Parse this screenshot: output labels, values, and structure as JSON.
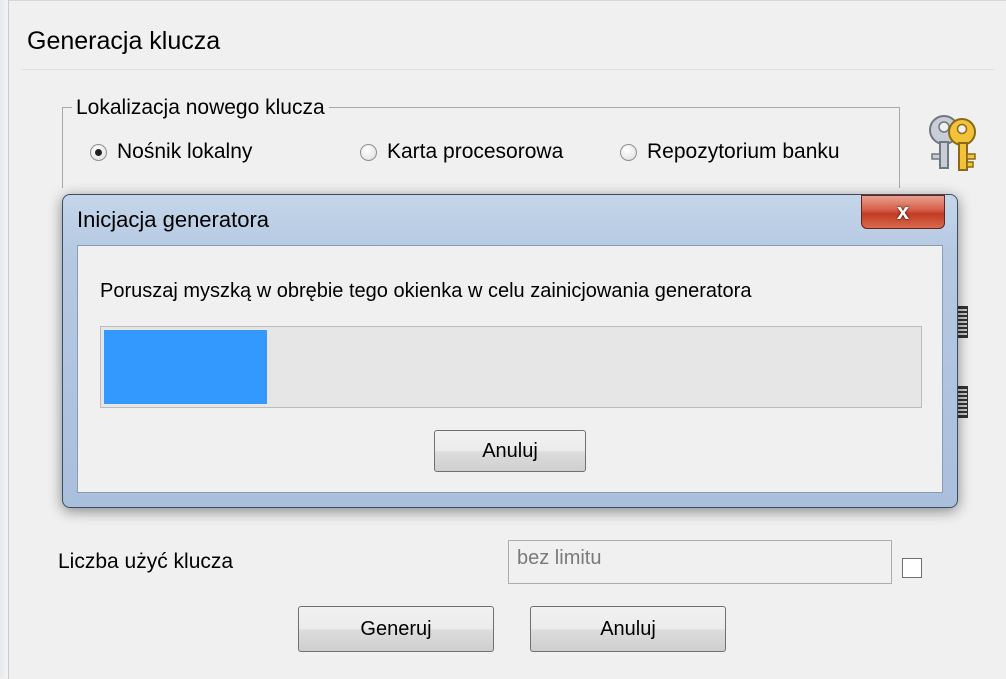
{
  "window": {
    "title": "Generacja klucza"
  },
  "location_group": {
    "label": "Lokalizacja nowego klucza",
    "options": [
      {
        "label": "Nośnik lokalny",
        "checked": true
      },
      {
        "label": "Karta procesorowa",
        "checked": false
      },
      {
        "label": "Repozytorium banku",
        "checked": false
      }
    ]
  },
  "usage": {
    "label": "Liczba użyć klucza",
    "value": "bez limitu",
    "checkbox_checked": false
  },
  "buttons": {
    "generate": "Generuj",
    "cancel": "Anuluj"
  },
  "dialog": {
    "title": "Inicjacja generatora",
    "close_glyph": "x",
    "message": "Poruszaj myszką w obrębie tego okienka w celu zainicjowania generatora",
    "progress_fraction": 0.2,
    "cancel": "Anuluj"
  },
  "colors": {
    "progress": "#3399ff",
    "close_button": "#c23a22"
  },
  "icons": [
    "keys-icon",
    "close-icon",
    "radio-icon"
  ]
}
